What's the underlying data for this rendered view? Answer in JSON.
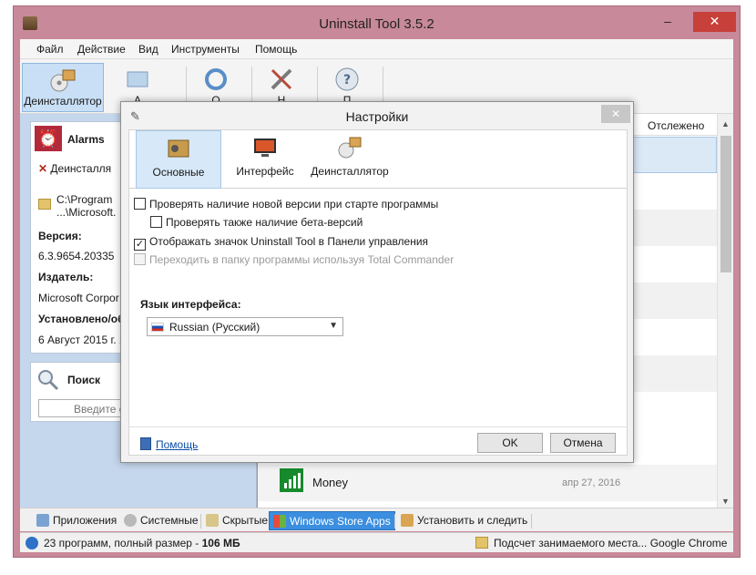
{
  "window": {
    "title": "Uninstall Tool 3.5.2",
    "min_glyph": "–",
    "max_glyph": "□"
  },
  "menu": [
    "Файл",
    "Действие",
    "Вид",
    "Инструменты",
    "Помощь"
  ],
  "toolbar": {
    "items": [
      {
        "label": "Деинсталлятор",
        "icon": "uninstaller-icon",
        "active": true
      },
      {
        "label": "А",
        "icon": "autorun-icon"
      },
      {
        "label": "О",
        "icon": "refresh-icon"
      },
      {
        "label": "Н",
        "icon": "tools-icon"
      },
      {
        "label": "П",
        "icon": "help-icon"
      }
    ]
  },
  "left_panel": {
    "app_name": "Alarms",
    "uninstall": "Деинсталля",
    "path_line1": "C:\\Program",
    "path_line2": "...\\Microsoft.",
    "version_label": "Версия:",
    "version_value": "6.3.9654.20335",
    "publisher_label": "Издатель:",
    "publisher_value": "Microsoft Corpor",
    "installed_label": "Установлено/об",
    "installed_value": "6 Август 2015 г. 2",
    "search_title": "Поиск",
    "search_placeholder": "Введите с"
  },
  "list": {
    "tracked_header": "Отслежено",
    "money_name": "Money",
    "money_date": "апр 27, 2016"
  },
  "tabs": [
    {
      "label": "Приложения",
      "icon": "apps-icon"
    },
    {
      "label": "Системные",
      "icon": "gear-icon"
    },
    {
      "label": "Скрытые",
      "icon": "hidden-icon"
    },
    {
      "label": "Windows Store Apps",
      "icon": "windows-icon",
      "active": true
    },
    {
      "label": "Установить и следить",
      "icon": "install-track-icon"
    }
  ],
  "status": {
    "count": "23 программ, полный размер - ",
    "size": "106 МБ",
    "right": "Подсчет занимаемого места... Google Chrome"
  },
  "dialog": {
    "title": "Настройки",
    "tabs": [
      {
        "label": "Основные",
        "active": true
      },
      {
        "label": "Интерфейс"
      },
      {
        "label": "Деинсталлятор"
      }
    ],
    "options": [
      {
        "label": "Проверять наличие новой версии при старте программы",
        "checked": false,
        "disabled": false
      },
      {
        "label": "Проверять также наличие бета-версий",
        "checked": false,
        "disabled": false
      },
      {
        "label": "Отображать значок Uninstall Tool в Панели управления",
        "checked": true,
        "disabled": false
      },
      {
        "label": "Переходить в папку программы используя Total Commander",
        "checked": false,
        "disabled": true
      }
    ],
    "lang_label": "Язык интерфейса:",
    "lang_value": "Russian (Русский)",
    "help_link": "Помощь",
    "ok": "OK",
    "cancel": "Отмена"
  },
  "colors": {
    "window_frame": "#c8899a",
    "accent": "#3b8ee0",
    "close_red": "#c7403a"
  }
}
